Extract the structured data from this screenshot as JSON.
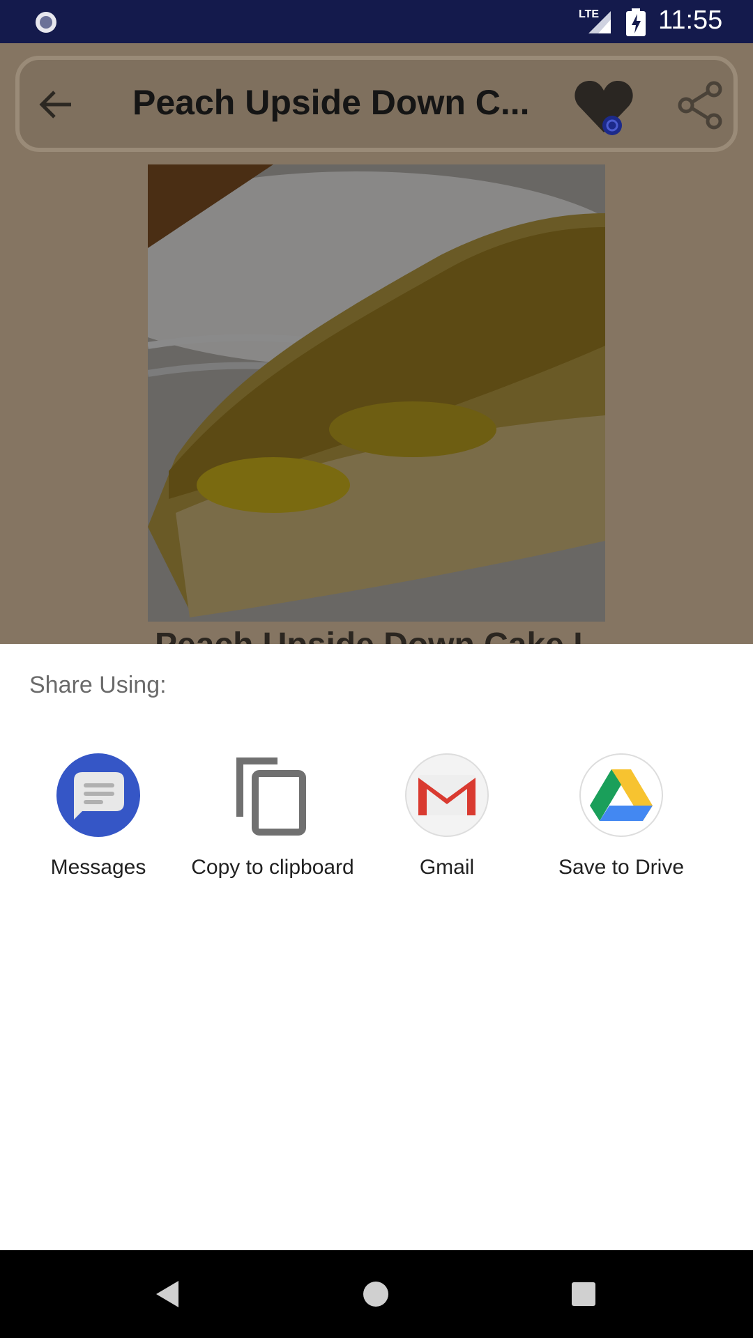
{
  "status_bar": {
    "network": "LTE",
    "time": "11:55"
  },
  "app": {
    "title": "Peach Upside Down C...",
    "heading": "Peach Upside Down Cake I"
  },
  "share_sheet": {
    "heading": "Share Using:",
    "targets": [
      {
        "label": "Messages",
        "icon": "messages-icon"
      },
      {
        "label": "Copy to clipboard",
        "icon": "copy-icon"
      },
      {
        "label": "Gmail",
        "icon": "gmail-icon"
      },
      {
        "label": "Save to Drive",
        "icon": "drive-icon"
      }
    ]
  },
  "nav_bar": {
    "buttons": [
      "back",
      "home",
      "recents"
    ]
  },
  "colors": {
    "status_bar": "#141a4c",
    "scrim": "#857562",
    "messages_blue": "#3556c6",
    "gmail_red": "#d93a30",
    "drive_green": "#1a9f5a",
    "drive_yellow": "#f7c330",
    "drive_blue": "#4388f2"
  }
}
